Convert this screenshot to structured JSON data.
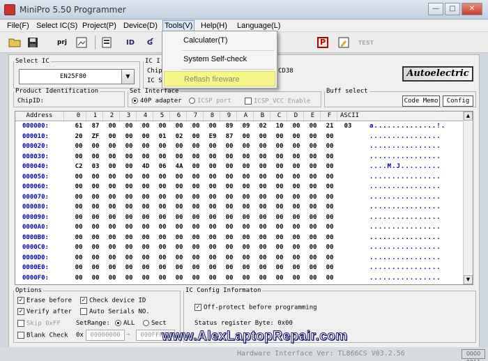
{
  "window": {
    "title": "MiniPro 5.50 Programmer"
  },
  "menu": [
    "File(F)",
    "Select IC(S)",
    "Project(P)",
    "Device(D)",
    "Tools(V)",
    "Help(H)",
    "Language(L)"
  ],
  "tools_menu": [
    "Calculater(T)",
    "System Self-check",
    "Reflash fireware"
  ],
  "toolbar": {
    "prj_label": "prj",
    "test_label": "TEST",
    "p_label": "P"
  },
  "select_ic": {
    "legend": "Select IC",
    "value": "EN25F80"
  },
  "ic_info": {
    "legend_partial": "IC I",
    "chip_partial": "Chip",
    "ics_partial": "IC S",
    "id_partial": "CD38"
  },
  "logo_text": "Autoelectric",
  "product_id": {
    "legend": "Product Identification",
    "label": "ChipID:"
  },
  "set_interface": {
    "legend": "Set Interface",
    "opt_40p": "40P adapter",
    "opt_icsp": "ICSP port",
    "opt_icsp_vcc": "ICSP_VCC Enable"
  },
  "buff_select": {
    "legend": "Buff select",
    "code_memo": "Code Memo",
    "config": "Config"
  },
  "hex": {
    "headers": [
      "Address",
      "0",
      "1",
      "2",
      "3",
      "4",
      "5",
      "6",
      "7",
      "8",
      "9",
      "A",
      "B",
      "C",
      "D",
      "E",
      "F",
      "ASCII"
    ],
    "rows": [
      {
        "addr": "000000:",
        "bytes": [
          "61",
          "87",
          "00",
          "00",
          "00",
          "00",
          "00",
          "00",
          "00",
          "89",
          "09",
          "02",
          "10",
          "00",
          "00",
          "21",
          "03"
        ],
        "ascii": "a..............!."
      },
      {
        "addr": "000010:",
        "bytes": [
          "20",
          "ZF",
          "00",
          "00",
          "00",
          "01",
          "02",
          "00",
          "E9",
          "87",
          "00",
          "00",
          "00",
          "00",
          "00",
          "00"
        ],
        "ascii": "................"
      },
      {
        "addr": "000020:",
        "bytes": [
          "00",
          "00",
          "00",
          "00",
          "00",
          "00",
          "00",
          "00",
          "00",
          "00",
          "00",
          "00",
          "00",
          "00",
          "00",
          "00"
        ],
        "ascii": "................"
      },
      {
        "addr": "000030:",
        "bytes": [
          "00",
          "00",
          "00",
          "00",
          "00",
          "00",
          "00",
          "00",
          "00",
          "00",
          "00",
          "00",
          "00",
          "00",
          "00",
          "00"
        ],
        "ascii": "................"
      },
      {
        "addr": "000040:",
        "bytes": [
          "C2",
          "03",
          "00",
          "00",
          "4D",
          "06",
          "4A",
          "00",
          "00",
          "00",
          "00",
          "00",
          "00",
          "00",
          "00",
          "00"
        ],
        "ascii": "....M.J........."
      },
      {
        "addr": "000050:",
        "bytes": [
          "00",
          "00",
          "00",
          "00",
          "00",
          "00",
          "00",
          "00",
          "00",
          "00",
          "00",
          "00",
          "00",
          "00",
          "00",
          "00"
        ],
        "ascii": "................"
      },
      {
        "addr": "000060:",
        "bytes": [
          "00",
          "00",
          "00",
          "00",
          "00",
          "00",
          "00",
          "00",
          "00",
          "00",
          "00",
          "00",
          "00",
          "00",
          "00",
          "00"
        ],
        "ascii": "................"
      },
      {
        "addr": "000070:",
        "bytes": [
          "00",
          "00",
          "00",
          "00",
          "00",
          "00",
          "00",
          "00",
          "00",
          "00",
          "00",
          "00",
          "00",
          "00",
          "00",
          "00"
        ],
        "ascii": "................"
      },
      {
        "addr": "000080:",
        "bytes": [
          "00",
          "00",
          "00",
          "00",
          "00",
          "00",
          "00",
          "00",
          "00",
          "00",
          "00",
          "00",
          "00",
          "00",
          "00",
          "00"
        ],
        "ascii": "................"
      },
      {
        "addr": "000090:",
        "bytes": [
          "00",
          "00",
          "00",
          "00",
          "00",
          "00",
          "00",
          "00",
          "00",
          "00",
          "00",
          "00",
          "00",
          "00",
          "00",
          "00"
        ],
        "ascii": "................"
      },
      {
        "addr": "0000A0:",
        "bytes": [
          "00",
          "00",
          "00",
          "00",
          "00",
          "00",
          "00",
          "00",
          "00",
          "00",
          "00",
          "00",
          "00",
          "00",
          "00",
          "00"
        ],
        "ascii": "................"
      },
      {
        "addr": "0000B0:",
        "bytes": [
          "00",
          "00",
          "00",
          "00",
          "00",
          "00",
          "00",
          "00",
          "00",
          "00",
          "00",
          "00",
          "00",
          "00",
          "00",
          "00"
        ],
        "ascii": "................"
      },
      {
        "addr": "0000C0:",
        "bytes": [
          "00",
          "00",
          "00",
          "00",
          "00",
          "00",
          "00",
          "00",
          "00",
          "00",
          "00",
          "00",
          "00",
          "00",
          "00",
          "00"
        ],
        "ascii": "................"
      },
      {
        "addr": "0000D0:",
        "bytes": [
          "00",
          "00",
          "00",
          "00",
          "00",
          "00",
          "00",
          "00",
          "00",
          "00",
          "00",
          "00",
          "00",
          "00",
          "00",
          "00"
        ],
        "ascii": "................"
      },
      {
        "addr": "0000E0:",
        "bytes": [
          "00",
          "00",
          "00",
          "00",
          "00",
          "00",
          "00",
          "00",
          "00",
          "00",
          "00",
          "00",
          "00",
          "00",
          "00",
          "00"
        ],
        "ascii": "................"
      },
      {
        "addr": "0000F0:",
        "bytes": [
          "00",
          "00",
          "00",
          "00",
          "00",
          "00",
          "00",
          "00",
          "00",
          "00",
          "00",
          "00",
          "00",
          "00",
          "00",
          "00"
        ],
        "ascii": "................"
      }
    ]
  },
  "options": {
    "legend": "Options",
    "erase_before": "Erase before",
    "check_device_id": "Check device ID",
    "verify_after": "Verify after",
    "auto_serials": "Auto Serials NO.",
    "skip_0xff": "Skip 0xFF",
    "set_range": "SetRange:",
    "all": "ALL",
    "sect": "Sect",
    "blank_check": "Blank Check",
    "ox": "0x",
    "range_from": "00000000",
    "range_to": "000FFFFF"
  },
  "ic_config": {
    "legend": "IC Config Informaton",
    "off_protect": "Off-protect before programming",
    "status_reg": "Status register Byte: 0x00"
  },
  "watermark": "www.AlexLaptopRepair.com",
  "statusbar": {
    "text": "Hardware Interface Ver: TL866CS V03.2.56",
    "box": "0000 0011"
  }
}
